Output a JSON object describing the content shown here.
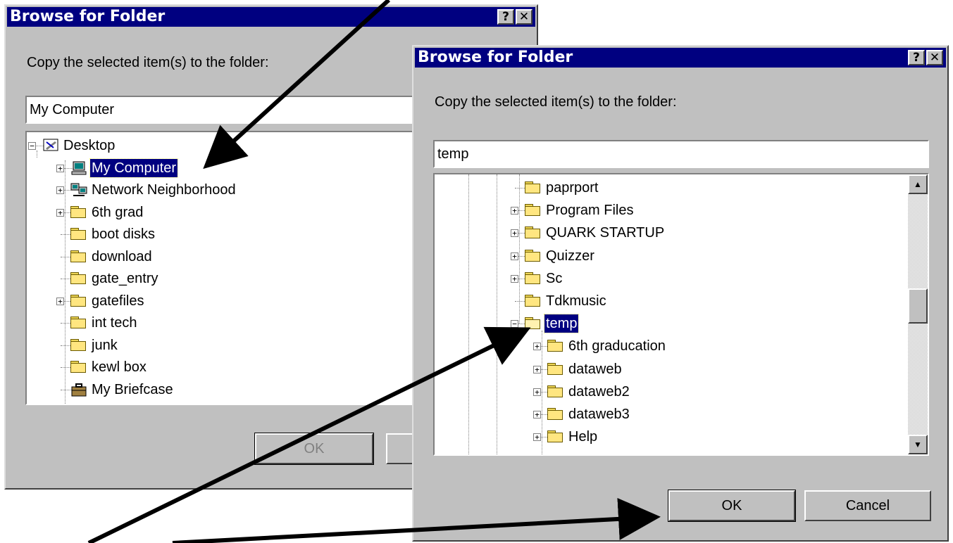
{
  "back_dialog": {
    "title": "Browse for Folder",
    "help_glyph": "?",
    "close_glyph": "✕",
    "prompt": "Copy the selected item(s) to the folder:",
    "folder_value": "My Computer",
    "tree": [
      {
        "label": "Desktop",
        "icon": "desktop-icon",
        "expander": "−"
      },
      {
        "label": "My Computer",
        "icon": "computer-icon",
        "expander": "+",
        "selected": true
      },
      {
        "label": "Network Neighborhood",
        "icon": "network-icon",
        "expander": "+"
      },
      {
        "label": "6th grad",
        "icon": "folder-icon",
        "expander": "+"
      },
      {
        "label": "boot disks",
        "icon": "folder-icon"
      },
      {
        "label": "download",
        "icon": "folder-icon"
      },
      {
        "label": "gate_entry",
        "icon": "folder-icon"
      },
      {
        "label": "gatefiles",
        "icon": "folder-icon",
        "expander": "+"
      },
      {
        "label": "int tech",
        "icon": "folder-icon"
      },
      {
        "label": "junk",
        "icon": "folder-icon"
      },
      {
        "label": "kewl box",
        "icon": "folder-icon"
      },
      {
        "label": "My Briefcase",
        "icon": "briefcase-icon"
      }
    ],
    "ok_label": "OK"
  },
  "front_dialog": {
    "title": "Browse for Folder",
    "help_glyph": "?",
    "close_glyph": "✕",
    "prompt": "Copy the selected item(s) to the folder:",
    "folder_value": "temp",
    "tree": [
      {
        "label": "paprport",
        "icon": "folder-icon"
      },
      {
        "label": "Program Files",
        "icon": "folder-icon",
        "expander": "+"
      },
      {
        "label": "QUARK STARTUP",
        "icon": "folder-icon",
        "expander": "+"
      },
      {
        "label": "Quizzer",
        "icon": "folder-icon",
        "expander": "+"
      },
      {
        "label": "Sc",
        "icon": "folder-icon",
        "expander": "+"
      },
      {
        "label": "Tdkmusic",
        "icon": "folder-icon"
      },
      {
        "label": "temp",
        "icon": "open-folder-icon",
        "expander": "−",
        "selected": true
      },
      {
        "label": "6th graducation",
        "icon": "folder-icon",
        "expander": "+",
        "child": true
      },
      {
        "label": "dataweb",
        "icon": "folder-icon",
        "expander": "+",
        "child": true
      },
      {
        "label": "dataweb2",
        "icon": "folder-icon",
        "expander": "+",
        "child": true
      },
      {
        "label": "dataweb3",
        "icon": "folder-icon",
        "expander": "+",
        "child": true
      },
      {
        "label": "Help",
        "icon": "folder-icon",
        "expander": "+",
        "child": true
      }
    ],
    "scroll_up_glyph": "▲",
    "scroll_down_glyph": "▼",
    "ok_label": "OK",
    "cancel_label": "Cancel"
  },
  "colors": {
    "titlebar": "#000080",
    "face": "#c0c0c0",
    "selection": "#000080"
  }
}
